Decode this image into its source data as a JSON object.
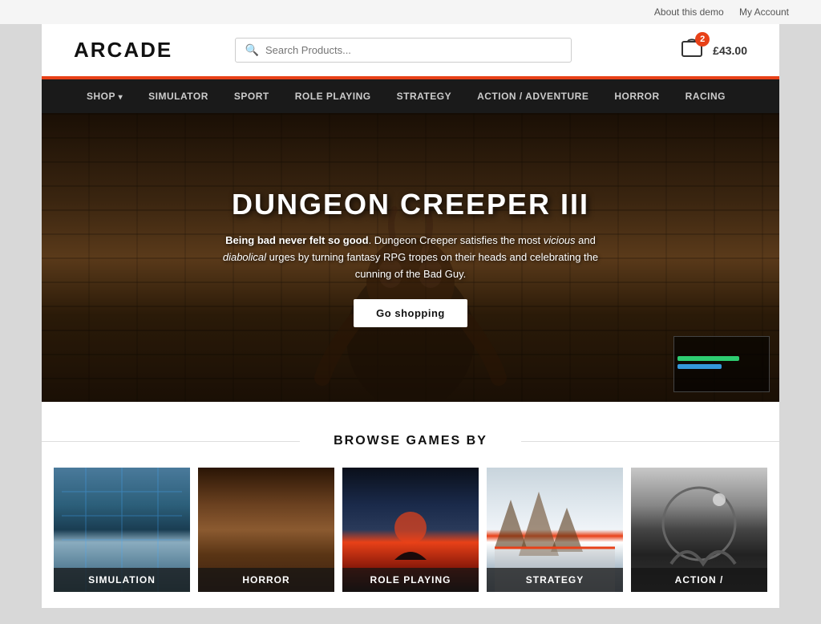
{
  "topbar": {
    "about": "About this demo",
    "account": "My Account"
  },
  "header": {
    "logo": "ARCADE",
    "search_placeholder": "Search Products...",
    "cart_count": "2",
    "cart_total": "£43.00"
  },
  "nav": {
    "items": [
      {
        "label": "SHOP",
        "has_dropdown": true
      },
      {
        "label": "SIMULATOR"
      },
      {
        "label": "SPORT"
      },
      {
        "label": "ROLE PLAYING"
      },
      {
        "label": "STRATEGY"
      },
      {
        "label": "ACTION / ADVENTURE"
      },
      {
        "label": "HORROR"
      },
      {
        "label": "RACING"
      }
    ]
  },
  "hero": {
    "title": "DUNGEON CREEPER III",
    "desc_bold": "Being bad never felt so good",
    "desc_text": ". Dungeon Creeper satisfies the most ",
    "desc_em1": "vicious",
    "desc_and": " and ",
    "desc_em2": "diabolical",
    "desc_rest": " urges by turning fantasy RPG tropes on their heads and celebrating the cunning of the Bad Guy.",
    "cta_label": "Go shopping"
  },
  "browse": {
    "heading": "BROWSE GAMES BY",
    "categories": [
      {
        "label": "Simulation",
        "style_class": "card-simulator"
      },
      {
        "label": "Horror",
        "style_class": "card-horror"
      },
      {
        "label": "Role Playing",
        "style_class": "card-role"
      },
      {
        "label": "Strategy",
        "style_class": "card-strategy"
      },
      {
        "label": "Action /",
        "style_class": "card-action"
      }
    ]
  }
}
